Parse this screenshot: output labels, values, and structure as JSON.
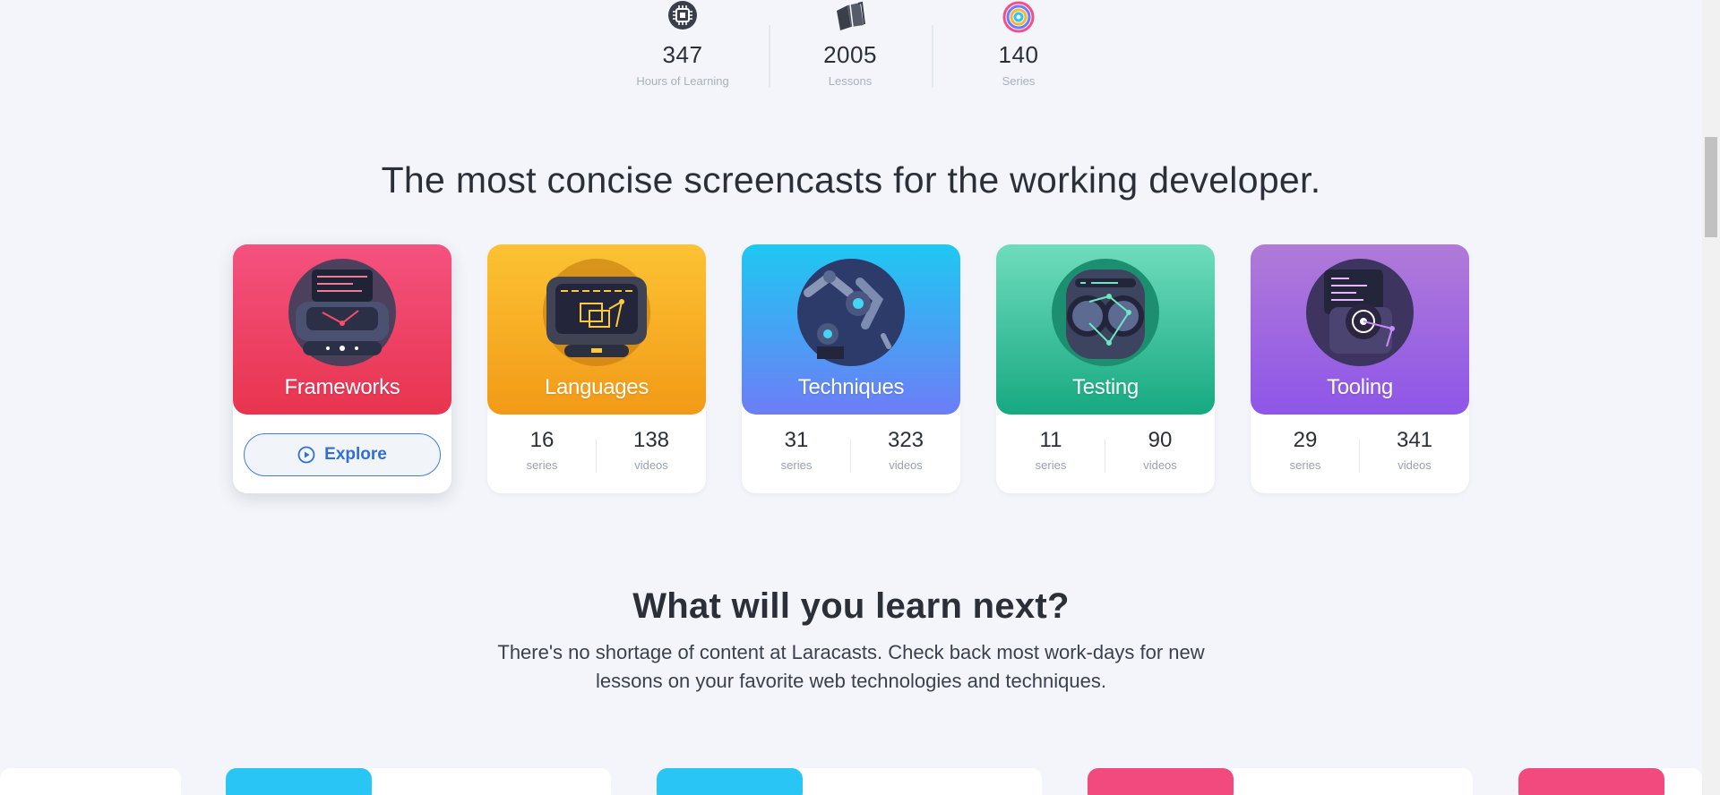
{
  "stats": [
    {
      "icon": "chip-icon",
      "value": "347",
      "label": "Hours of Learning"
    },
    {
      "icon": "books-icon",
      "value": "2005",
      "label": "Lessons"
    },
    {
      "icon": "rings-icon",
      "value": "140",
      "label": "Series"
    }
  ],
  "headline": "The most concise screencasts for the working developer.",
  "topics": [
    {
      "title": "Frameworks",
      "button_label": "Explore",
      "button_icon": "play-circle-icon"
    },
    {
      "title": "Languages",
      "series": "16",
      "series_unit": "series",
      "videos": "138",
      "videos_unit": "videos"
    },
    {
      "title": "Techniques",
      "series": "31",
      "series_unit": "series",
      "videos": "323",
      "videos_unit": "videos"
    },
    {
      "title": "Testing",
      "series": "11",
      "series_unit": "series",
      "videos": "90",
      "videos_unit": "videos"
    },
    {
      "title": "Tooling",
      "series": "29",
      "series_unit": "series",
      "videos": "341",
      "videos_unit": "videos"
    }
  ],
  "next": {
    "title": "What will you learn next?",
    "description": "There's no shortage of content at Laracasts. Check back most work-days for new lessons on your favorite web technologies and techniques."
  },
  "colors": {
    "frameworks": "#e8344f",
    "languages": "#f29a17",
    "techniques": "#5b8ff5",
    "testing": "#16a981",
    "tooling": "#8e56e8",
    "accent": "#2f6fd6"
  }
}
